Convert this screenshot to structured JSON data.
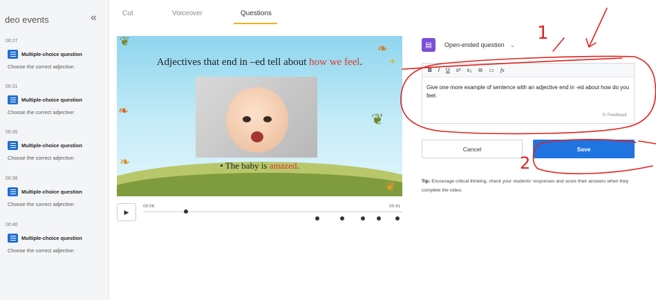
{
  "sidebar": {
    "title": "deo events",
    "collapse_glyph": "«",
    "events": [
      {
        "time": "00:27",
        "label": "Multiple-choice question",
        "subtitle": "Choose the correct adjective:"
      },
      {
        "time": "00:31",
        "label": "Multiple-choice question",
        "subtitle": "Choose the correct adjective:"
      },
      {
        "time": "00:35",
        "label": "Multiple-choice question",
        "subtitle": "Choose the correct adjective:"
      },
      {
        "time": "00:38",
        "label": "Multiple-choice question",
        "subtitle": "Choose the correct adjective:"
      },
      {
        "time": "00:40",
        "label": "Multiple-choice question",
        "subtitle": "Choose the correct adjective:"
      }
    ]
  },
  "tabs": [
    {
      "label": "Cut",
      "active": false
    },
    {
      "label": "Voiceover",
      "active": false
    },
    {
      "label": "Questions",
      "active": true
    }
  ],
  "video": {
    "title_prefix": "Adjectives that end in –ed tell about ",
    "title_highlight": "how we feel",
    "title_suffix": ".",
    "caption_prefix": "• The baby is ",
    "caption_highlight": "amazed",
    "caption_suffix": "."
  },
  "player": {
    "play_glyph": "▶",
    "current_time": "00:06",
    "end_time": "00:41",
    "progress": 0.16,
    "marker_count": 5
  },
  "question_panel": {
    "type_label": "Open-ended question",
    "type_chevron": "⌄",
    "toolbar": [
      "B",
      "I",
      "U",
      "x²",
      "x₂",
      "⊖",
      "▭",
      "fx"
    ],
    "question_text": "Give one more example of sentence with an adjective end in -ed about how do you feel.",
    "feedback_label": "Feedback",
    "cancel_label": "Cancel",
    "save_label": "Save",
    "tip_label": "Tip:",
    "tip_text": " Encourage critical thinking, check your students' responses and score their answers when they complete the video."
  },
  "annotations": {
    "label_1": "1",
    "label_2": "2",
    "color": "#e0211d"
  },
  "colors": {
    "accent": "#1f74e0",
    "tab_underline": "#f0b11b",
    "question_icon": "#7b4fd6",
    "highlight_text": "#d63b2b"
  }
}
